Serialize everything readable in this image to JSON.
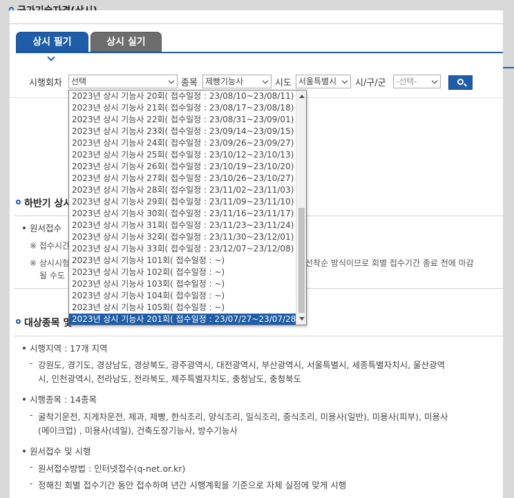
{
  "page": {
    "title": "국가기술자격(상시)"
  },
  "tabs": [
    {
      "label": "상시 필기",
      "active": true
    },
    {
      "label": "상시 실기",
      "active": false
    }
  ],
  "search": {
    "round_label": "시행회차",
    "round_value": "선택",
    "type_label": "종목",
    "type_value": "제빵기능사",
    "province_label": "시도",
    "province_value": "서울특별시",
    "city_label": "시/구/군",
    "city_value": "-선택-",
    "search_icon": "search-icon"
  },
  "dropdown": {
    "items": [
      "2023년 상시 기능사 20회( 접수일정 : 23/08/10~23/08/11)",
      "2023년 상시 기능사 21회( 접수일정 : 23/08/17~23/08/18)",
      "2023년 상시 기능사 22회( 접수일정 : 23/08/31~23/09/01)",
      "2023년 상시 기능사 23회( 접수일정 : 23/09/14~23/09/15)",
      "2023년 상시 기능사 24회( 접수일정 : 23/09/26~23/09/27)",
      "2023년 상시 기능사 25회( 접수일정 : 23/10/12~23/10/13)",
      "2023년 상시 기능사 26회( 접수일정 : 23/10/19~23/10/20)",
      "2023년 상시 기능사 27회( 접수일정 : 23/10/26~23/10/27)",
      "2023년 상시 기능사 28회( 접수일정 : 23/11/02~23/11/03)",
      "2023년 상시 기능사 29회( 접수일정 : 23/11/09~23/11/10)",
      "2023년 상시 기능사 30회( 접수일정 : 23/11/16~23/11/17)",
      "2023년 상시 기능사 31회( 접수일정 : 23/11/23~23/11/24)",
      "2023년 상시 기능사 32회( 접수일정 : 23/11/30~23/12/01)",
      "2023년 상시 기능사 33회( 접수일정 : 23/12/07~23/12/08)",
      "2023년 상시 기능사 101회( 접수일정 : ~)",
      "2023년 상시 기능사 102회( 접수일정 : ~)",
      "2023년 상시 기능사 103회( 접수일정 : ~)",
      "2023년 상시 기능사 104회( 접수일정 : ~)",
      "2023년 상시 기능사 105회( 접수일정 : ~)",
      "2023년 상시 기능사 201회( 접수일정 : 23/07/27~23/07/28)"
    ],
    "selected_index": 19
  },
  "section1": {
    "title_visible": "하반기 상시",
    "item1_visible": "원서접수",
    "note1_visible": "※ 접수시간",
    "note2_start": "※ 상시시험",
    "note2_end": "선착순 방식이므로 회별 접수기간 종료 전에 마감",
    "note2_line2": "될 수도"
  },
  "section2": {
    "title_visible": "대상종목 및",
    "region_title": "시행지역 : 17개 지역",
    "region_line1": "강원도, 경기도, 경상남도, 경상북도, 광주광역시, 대전광역시, 부산광역시, 서울특별시, 세종특별자치시, 울산광역",
    "region_line2": "시, 인천광역시, 전라남도, 전라북도, 제주특별자치도, 충청남도, 충청북도",
    "types_title": "시행종목 : 14종목",
    "types_line1": "굴착기운전, 지게차운전, 제과, 제빵, 한식조리, 양식조리, 일식조리, 중식조리, 미용사(일반), 미용사(피부), 미용사",
    "types_line2": "(메이크업) , 미용사(네일), 건축도장기능사, 방수기능사",
    "apply_title": "원서접수 및 시행",
    "apply_line1": "원서접수방법 : 인터넷접수(q-net.or.kr)",
    "apply_line2": "정해진 회별 접수기간 동안 접수하며 년간 시행계획을 기준으로 자체 실정에 맞게 시행"
  }
}
